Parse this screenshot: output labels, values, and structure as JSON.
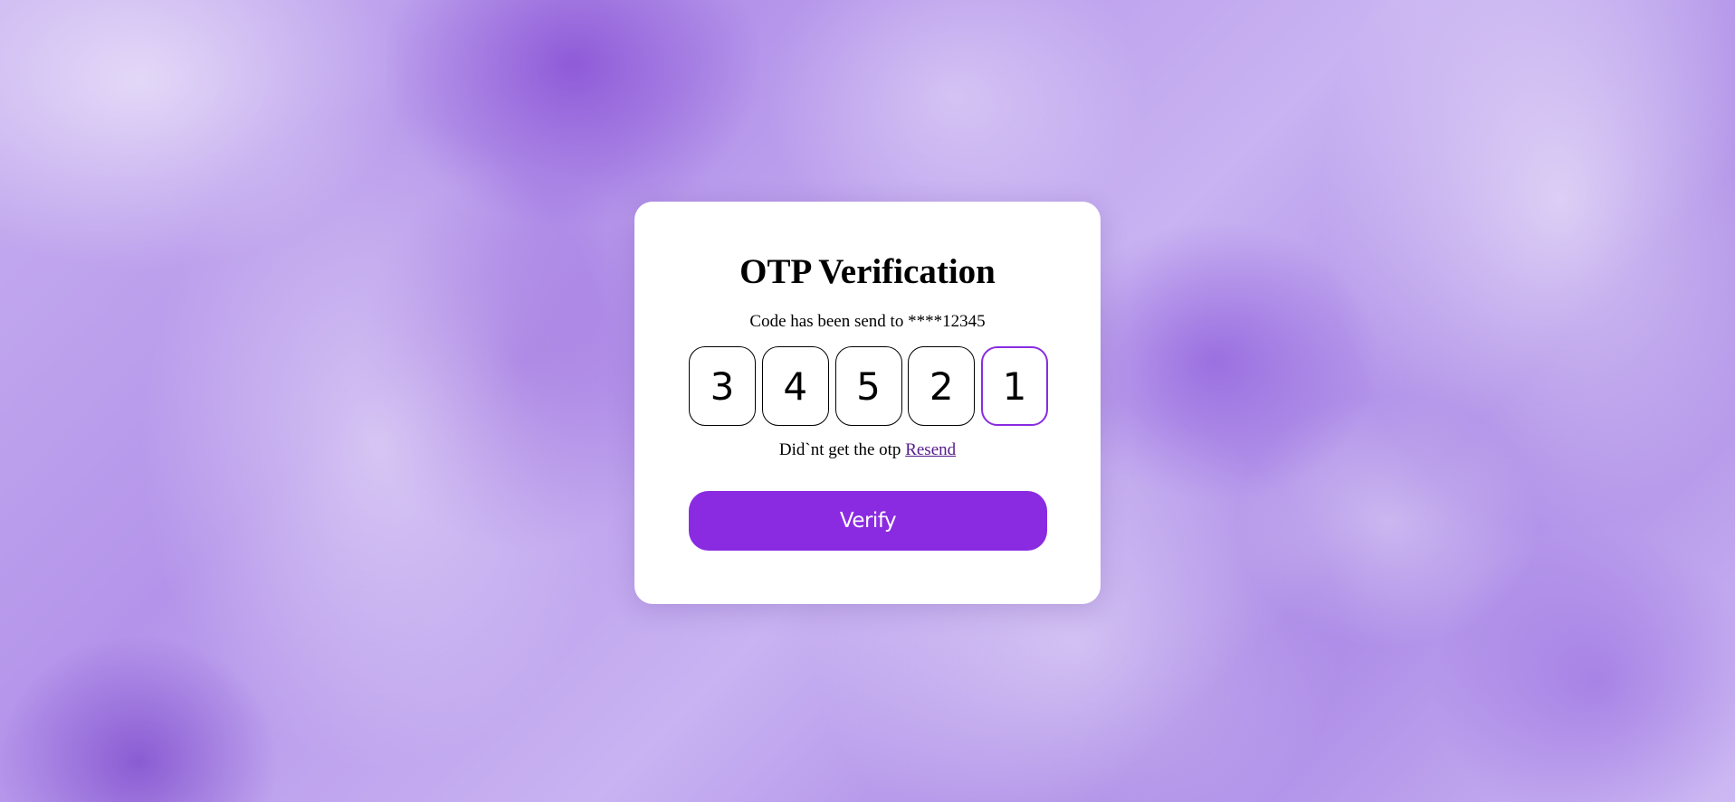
{
  "card": {
    "title": "OTP Verification",
    "subtitle": "Code has been send to ****12345",
    "otp_digits": [
      "3",
      "4",
      "5",
      "2",
      "1"
    ],
    "resend_prompt": "Did`nt get the otp",
    "resend_link": "Resend",
    "verify_label": "Verify"
  },
  "colors": {
    "accent": "#8a2be2",
    "card_background": "#ffffff",
    "link": "#551a8b"
  }
}
